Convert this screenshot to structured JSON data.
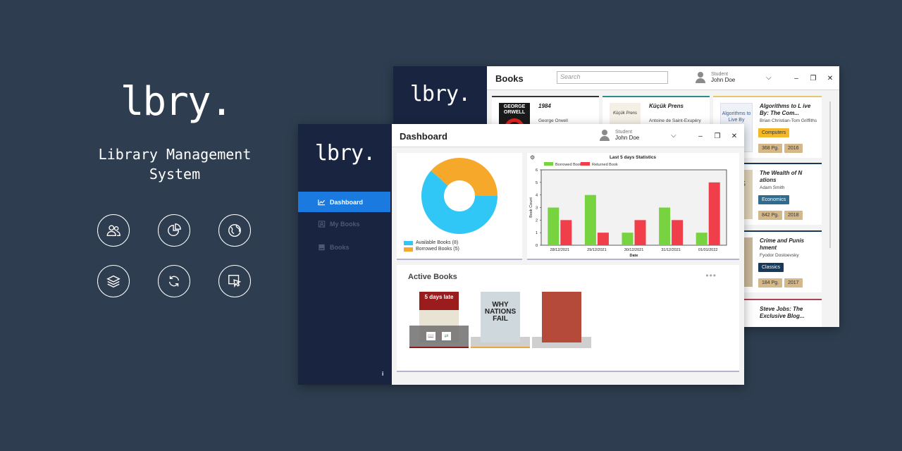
{
  "promo": {
    "logo": "lbry.",
    "subtitle": "Library Management System",
    "icons": [
      "users-icon",
      "pie-chart-icon",
      "globe-icon",
      "layers-icon",
      "refresh-icon",
      "cursor-icon"
    ]
  },
  "books_window": {
    "logo": "lbry.",
    "title": "Books",
    "search_placeholder": "Search",
    "user": {
      "role": "Student",
      "name": "John Doe"
    },
    "cards": [
      {
        "title": "1984",
        "author": "George Orwell",
        "accent": "#333333",
        "cover_text": "GEORGE ORWELL"
      },
      {
        "title": "Küçük Prens",
        "author": "Antoine de Saint-Exupéry",
        "accent": "#2e8b8b",
        "cover_text": "Küçük Prens"
      },
      {
        "title": "Algorithms to L ive By: The Com...",
        "author": "Brian Christian-Tom Griffiths",
        "accent": "#e8c66a",
        "cover_text": "Algorithms to Live By",
        "category": "Computers",
        "pages": "368 Pg.",
        "year": "2016"
      },
      {
        "title": "The Wealth of N ations",
        "author": "Adam Smith",
        "accent": "#183a5a",
        "cover_text": "H NS",
        "category": "Economics",
        "pages": "842 Pg.",
        "year": "2018"
      },
      {
        "title": "Crime and Punis hment",
        "author": "Fyodor Dostoevsky",
        "accent": "#183a5a",
        "category": "Classics",
        "pages": "184 Pg.",
        "year": "2017"
      },
      {
        "title": "Steve Jobs: The Exclusive Blog...",
        "author": "",
        "accent": "#aa4455"
      }
    ]
  },
  "dashboard_window": {
    "logo": "lbry.",
    "title": "Dashboard",
    "user": {
      "role": "Student",
      "name": "John Doe"
    },
    "nav": [
      {
        "label": "Dashboard",
        "icon": "line-chart-icon",
        "active": true
      },
      {
        "label": "My Books",
        "icon": "user-book-icon",
        "active": false
      },
      {
        "label": "Books",
        "icon": "book-icon",
        "active": false
      }
    ],
    "info": "i",
    "donut_legend": [
      "Available Books (8)",
      "Borrowed Books (5)"
    ],
    "active_books": {
      "title": "Active Books",
      "more": "•••",
      "items": [
        {
          "late_label": "5 days late",
          "accent": "#8b1a1a"
        },
        {
          "cover_text": "WHY NATIONS FAIL",
          "accent": "#e8a83a"
        },
        {
          "cover_text": "",
          "accent": "#cfcfcf"
        }
      ]
    }
  },
  "colors": {
    "available": "#30c6f5",
    "borrowed": "#f5a82a",
    "borrowed_book": "#77d440",
    "returned_book": "#f03e4a",
    "sidebar": "#182440",
    "active_nav": "#1b7adf"
  },
  "chart_data": [
    {
      "type": "pie",
      "categories": [
        "Available Books (8)",
        "Borrowed Books (5)"
      ],
      "values": [
        8,
        5
      ],
      "donut": true,
      "legend": "bottom-left"
    },
    {
      "type": "bar",
      "title": "Last 5 days Statistics",
      "xlabel": "Date",
      "ylabel": "Book Count",
      "categories": [
        "28/12/2021",
        "29/12/2021",
        "30/12/2021",
        "31/12/2021",
        "01/01/2022"
      ],
      "series": [
        {
          "name": "Borrowed Book",
          "values": [
            3,
            4,
            1,
            3,
            1
          ]
        },
        {
          "name": "Returned Book",
          "values": [
            2,
            1,
            2,
            2,
            5
          ]
        }
      ],
      "ylim": [
        0,
        6
      ],
      "yticks": [
        "0",
        "1",
        "2",
        "3",
        "4",
        "5",
        "6"
      ],
      "grid": false,
      "legend": "top-left"
    }
  ]
}
